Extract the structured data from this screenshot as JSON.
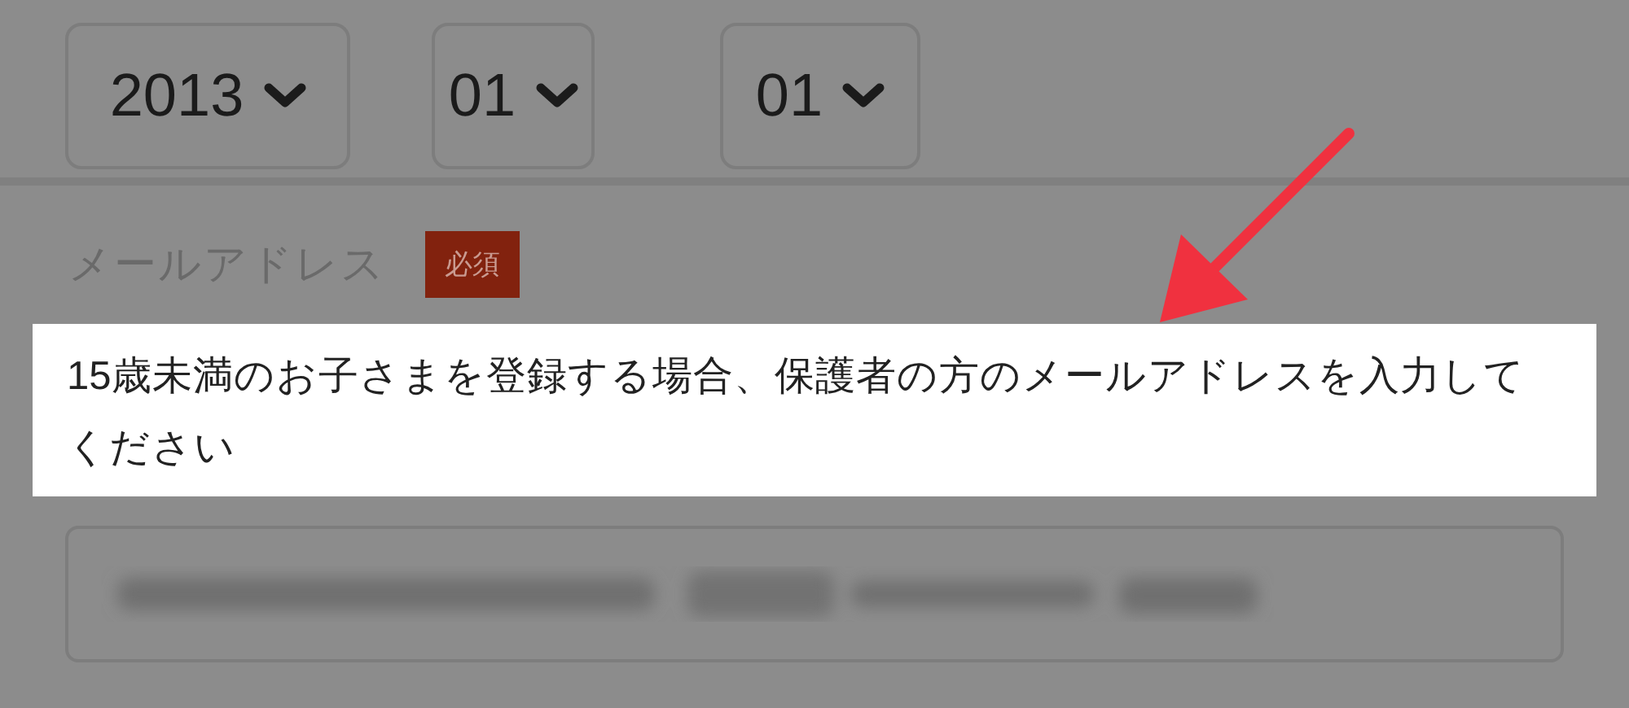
{
  "birthdate_selects": [
    {
      "value": "2013"
    },
    {
      "value": "01"
    },
    {
      "value": "01"
    }
  ],
  "email_field": {
    "label": "メールアドレス",
    "required_badge": "必須",
    "note": "15歳未満のお子さまを登録する場合、保護者の方のメールアドレスを入力してください"
  }
}
